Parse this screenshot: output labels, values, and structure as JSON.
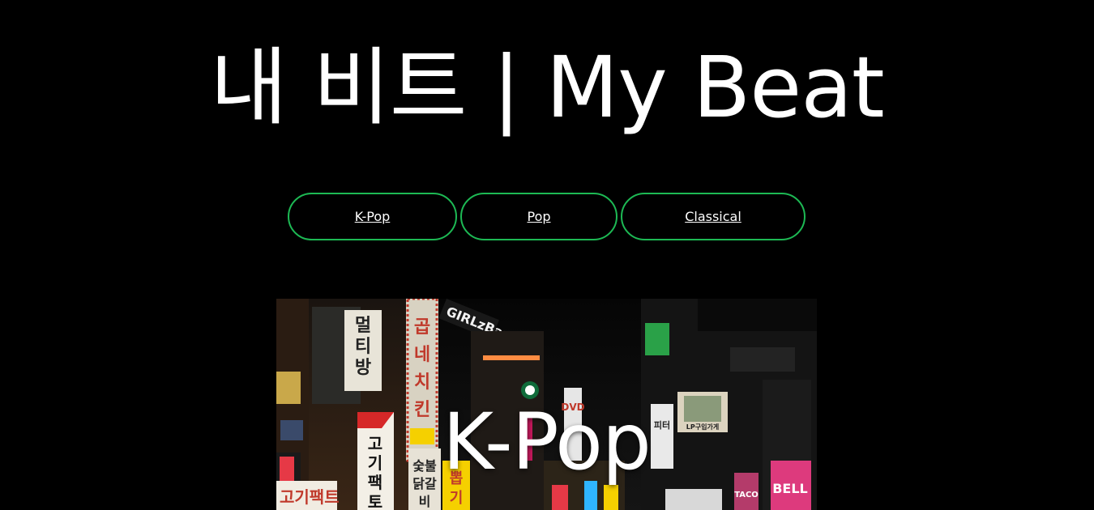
{
  "header": {
    "title": "내 비트 | My Beat"
  },
  "nav": {
    "items": [
      {
        "label": "K-Pop"
      },
      {
        "label": "Pop"
      },
      {
        "label": "Classical"
      }
    ]
  },
  "hero": {
    "title": "K-Pop",
    "signs": {
      "multiroom": "멀티방",
      "gopchang": "곱네치킨",
      "girlzbar": "GIRLzBar",
      "gogi": "고기팩토리",
      "sutbul": "숯불닭갈비",
      "ppopgi": "뽑기",
      "lp": "LP구입가게",
      "dvd": "DVD",
      "bell": "BELL",
      "taco": "TACO"
    }
  },
  "colors": {
    "background": "#000000",
    "accent_border": "#1db954",
    "text": "#ffffff"
  }
}
